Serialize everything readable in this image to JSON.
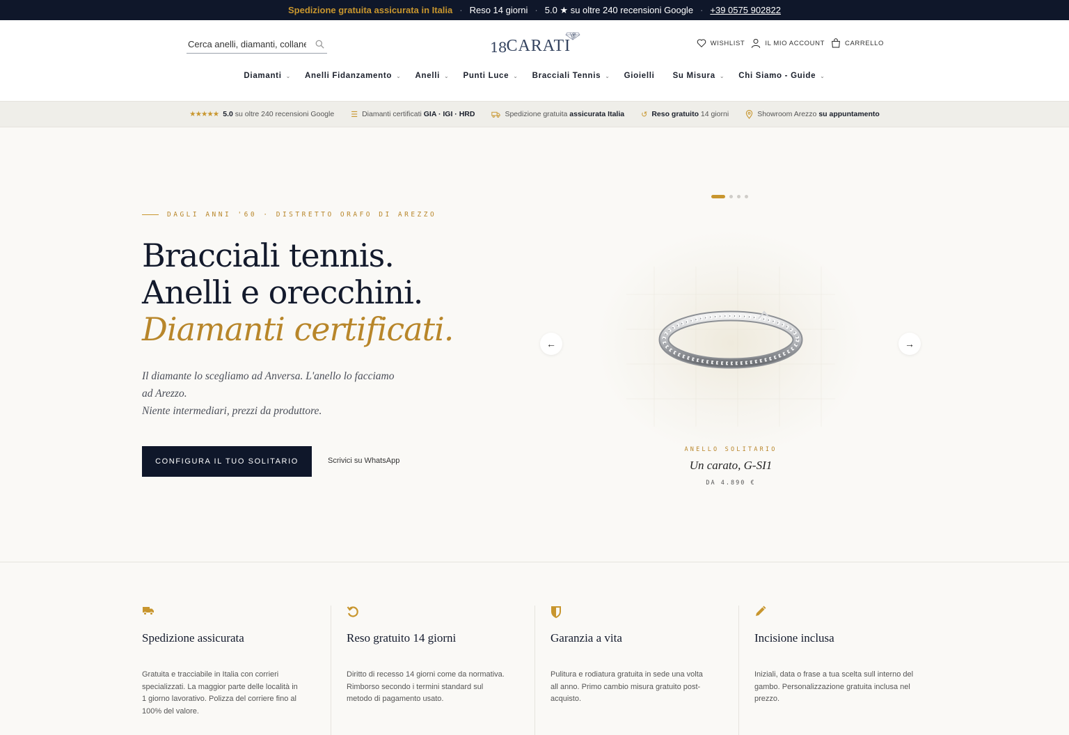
{
  "topbar": {
    "shipping": "Spedizione gratuita assicurata in Italia",
    "returns": "Reso 14 giorni",
    "rating": "5.0 ★ su oltre 240 recensioni Google",
    "phone": "+39 0575 902822"
  },
  "header": {
    "search_placeholder": "Cerca anelli, diamanti, collane..",
    "logo_num": "18",
    "logo_word": "CARATI",
    "logo_reg": "®",
    "wishlist": "WISHLIST",
    "account": "IL MIO ACCOUNT",
    "cart": "CARRELLO"
  },
  "nav": [
    {
      "label": "Diamanti",
      "has_menu": true
    },
    {
      "label": "Anelli Fidanzamento",
      "has_menu": true
    },
    {
      "label": "Anelli",
      "has_menu": true
    },
    {
      "label": "Punti Luce",
      "has_menu": true
    },
    {
      "label": "Bracciali Tennis",
      "has_menu": true
    },
    {
      "label": "Gioielli",
      "has_menu": false
    },
    {
      "label": "Su Misura",
      "has_menu": true
    },
    {
      "label": "Chi Siamo - Guide",
      "has_menu": true
    }
  ],
  "trust": {
    "stars": "★★★★★",
    "rating_bold": "5.0",
    "rating_rest": "su oltre 240 recensioni Google",
    "cert_pre": "Diamanti certificati",
    "cert_bold": "GIA · IGI · HRD",
    "ship_pre": "Spedizione gratuita",
    "ship_bold": "assicurata Italia",
    "return_bold": "Reso gratuito",
    "return_rest": "14 giorni",
    "showroom_pre": "Showroom Arezzo",
    "showroom_bold": "su appuntamento"
  },
  "hero": {
    "eyebrow": "DAGLI ANNI '60 · DISTRETTO ORAFO DI AREZZO",
    "line1": "Bracciali tennis.",
    "line2": "Anelli e orecchini.",
    "line3": "Diamanti certificati.",
    "lead1": "Il diamante lo scegliamo ad Anversa. L'anello lo facciamo ad Arezzo.",
    "lead2": "Niente intermediari, prezzi da produttore.",
    "cta": "CONFIGURA IL TUO SOLITARIO",
    "whatsapp": "Scrivici su WhatsApp",
    "slider": {
      "total": 4,
      "active": 1
    },
    "product_eyebrow": "ANELLO SOLITARIO",
    "product_name": "Un carato, G-SI1",
    "product_price": "DA 4.890 €",
    "arrow_left": "←",
    "arrow_right": "→"
  },
  "features": [
    {
      "icon": "truck-icon",
      "title": "Spedizione assicurata",
      "text": "Gratuita e tracciabile in Italia con corrieri specializzati. La maggior parte delle località in 1 giorno lavorativo. Polizza del corriere fino al 100% del valore."
    },
    {
      "icon": "return-icon",
      "title": "Reso gratuito 14 giorni",
      "text": "Diritto di recesso 14 giorni come da normativa. Rimborso secondo i termini standard sul metodo di pagamento usato."
    },
    {
      "icon": "shield-icon",
      "title": "Garanzia a vita",
      "text": "Pulitura e rodiatura gratuita in sede una volta all anno. Primo cambio misura gratuito post-acquisto."
    },
    {
      "icon": "pencil-icon",
      "title": "Incisione inclusa",
      "text": "Iniziali, data o frase a tua scelta sull interno del gambo. Personalizzazione gratuita inclusa nel prezzo."
    }
  ],
  "colors": {
    "navy": "#0f172a",
    "gold": "#c8962e",
    "bg": "#faf9f6"
  }
}
